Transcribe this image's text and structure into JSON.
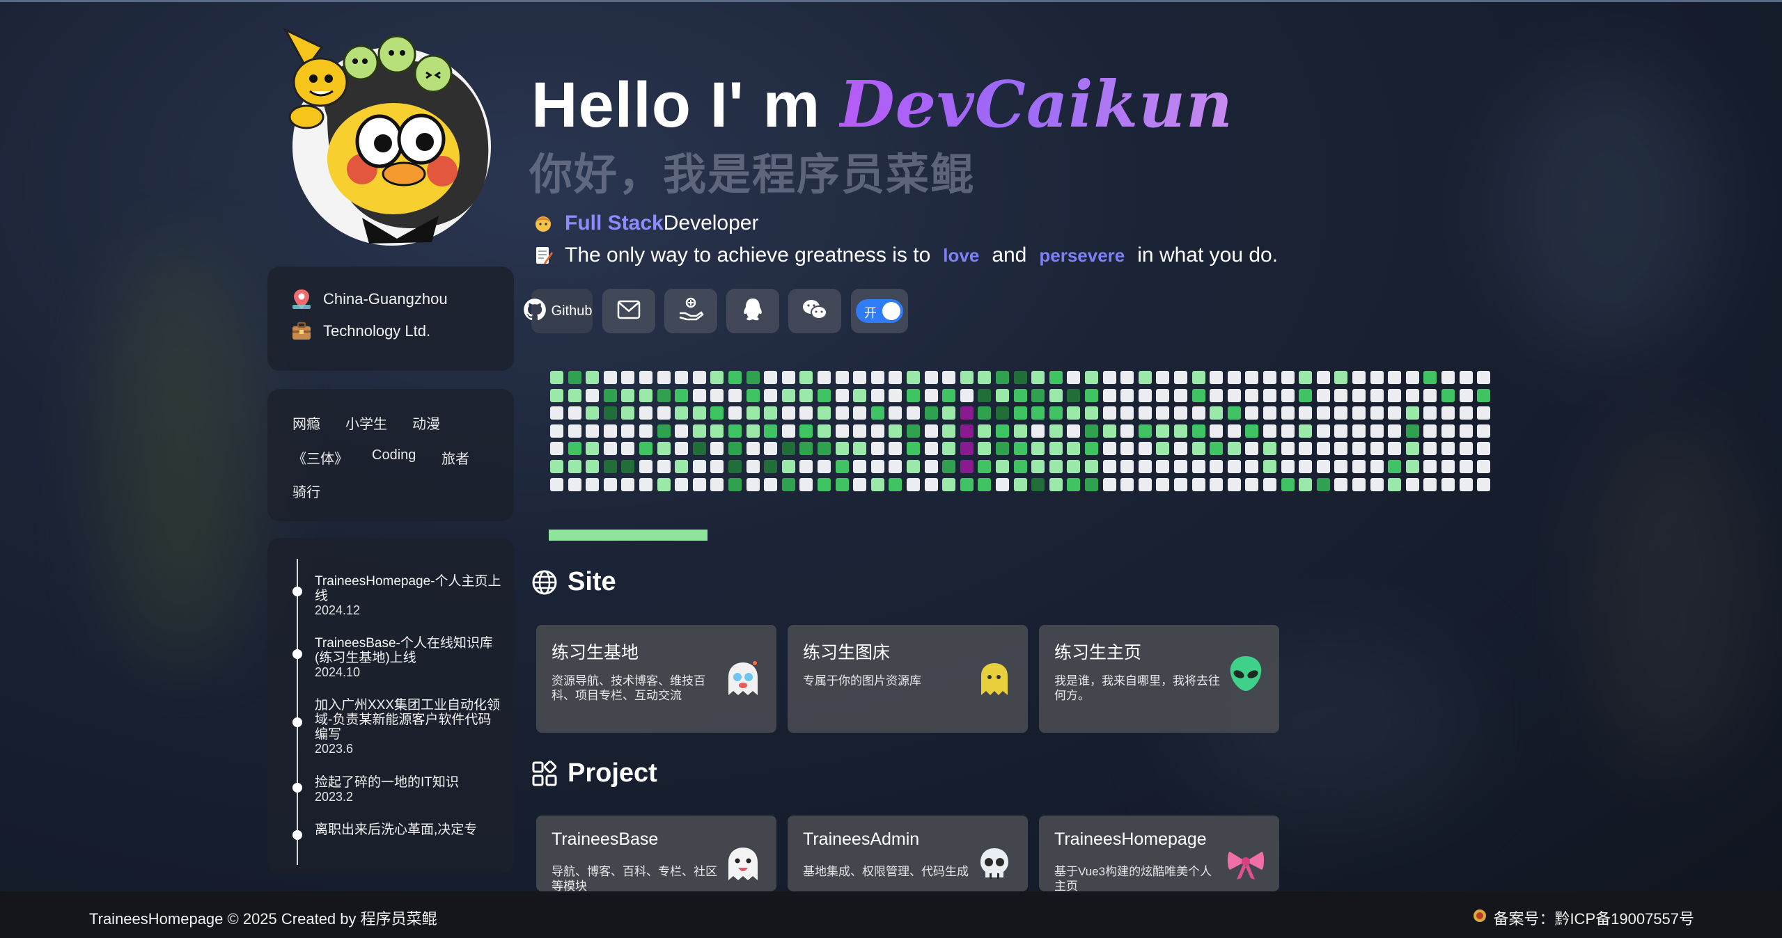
{
  "profile": {
    "location": "China-Guangzhou",
    "company": "Technology Ltd."
  },
  "tags": [
    "网瘾",
    "小学生",
    "动漫",
    "《三体》",
    "Coding",
    "旅者",
    "骑行"
  ],
  "timeline": [
    {
      "text": "TraineesHomepage-个人主页上线",
      "date": "2024.12"
    },
    {
      "text": "TraineesBase-个人在线知识库(练习生基地)上线",
      "date": "2024.10"
    },
    {
      "text": "加入广州XXX集团工业自动化领域-负责某新能源客户软件代码编写",
      "date": "2023.6"
    },
    {
      "text": "捡起了碎的一地的IT知识",
      "date": "2023.2"
    },
    {
      "text": "离职出来后洗心革面,决定专",
      "date": ""
    }
  ],
  "hero": {
    "hello": "Hello I' m ",
    "name": "DevCaikun",
    "subtitle_cn": "你好，我是程序员菜鲲",
    "role_highlight": "Full Stack",
    "role_rest": " Developer",
    "quote_a": "The only way to achieve greatness is to",
    "quote_love": "love",
    "quote_and": "and",
    "quote_persevere": "persevere",
    "quote_b": "in what you do."
  },
  "social": {
    "github_label": "Github",
    "toggle_label": "开",
    "icons": [
      "github-icon",
      "mail-icon",
      "donate-icon",
      "qq-icon",
      "wechat-icon",
      "theme-toggle"
    ]
  },
  "contrib_colors": {
    "empty": "#ebedf0",
    "l1": "#9be9a8",
    "l2": "#40c463",
    "l3": "#30a14e",
    "l4": "#216e39",
    "accent": "#8a1a8f"
  },
  "progress": {
    "value": 0.28
  },
  "sections": {
    "site": "Site",
    "project": "Project"
  },
  "site_cards": [
    {
      "title": "练习生基地",
      "desc": "资源导航、技术博客、维技百科、项目专栏、互动交流",
      "icon": "ghost-emoji-icon"
    },
    {
      "title": "练习生图床",
      "desc": "专属于你的图片资源库",
      "icon": "yellow-ghost-icon"
    },
    {
      "title": "练习生主页",
      "desc": "我是谁，我来自哪里，我将去往何方。",
      "icon": "alien-icon"
    }
  ],
  "project_cards": [
    {
      "title": "TraineesBase",
      "desc": "导航、博客、百科、专栏、社区等模块",
      "icon": "ghost-tongue-icon"
    },
    {
      "title": "TraineesAdmin",
      "desc": "基地集成、权限管理、代码生成",
      "icon": "skull-icon"
    },
    {
      "title": "TraineesHomepage",
      "desc": "基于Vue3构建的炫酷唯美个人主页",
      "icon": "ribbon-icon"
    }
  ],
  "footer": {
    "left": "TraineesHomepage © 2025 Created by 程序员菜鲲",
    "right": "备案号：黔ICP备19007557号"
  }
}
